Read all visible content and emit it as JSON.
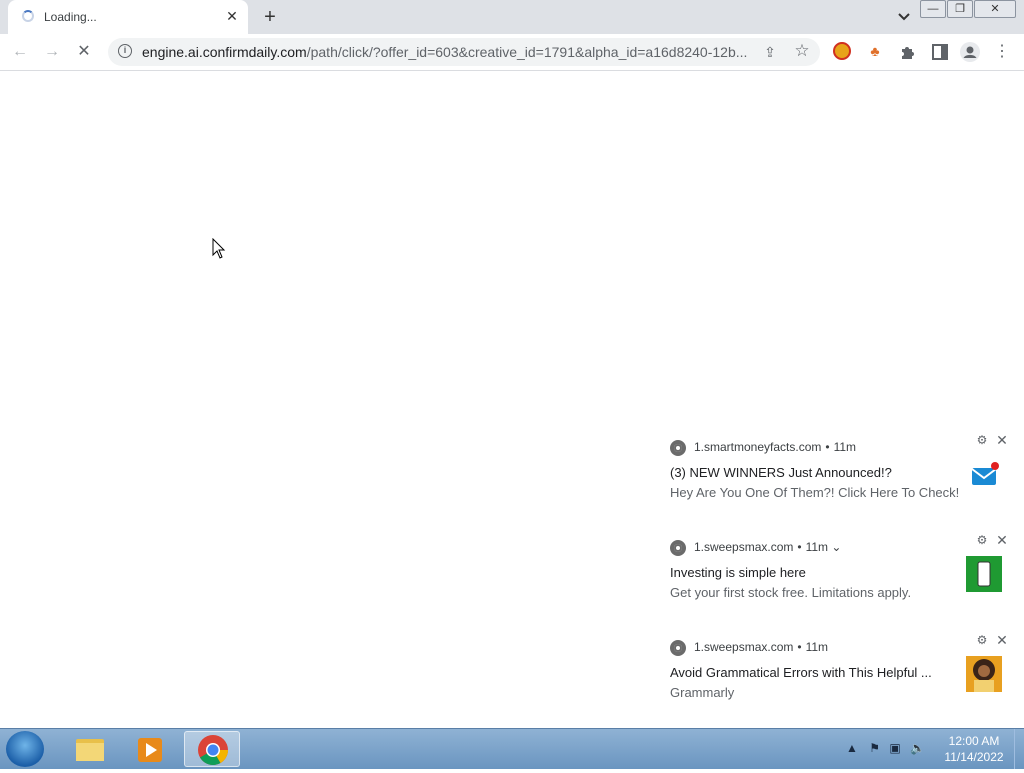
{
  "tab": {
    "title": "Loading...",
    "close": "✕",
    "new_tab": "+"
  },
  "window_controls": {
    "minimize": "—",
    "restore": "❐",
    "close": "✕"
  },
  "toolbar": {
    "back": "←",
    "forward": "→",
    "stop": "✕",
    "url_host": "engine.ai.confirmdaily.com",
    "url_rest": "/path/click/?offer_id=603&creative_id=1791&alpha_id=a16d8240-12b...",
    "menu": "⋮"
  },
  "notifications": [
    {
      "source": "1.smartmoneyfacts.com",
      "time": "11m",
      "title": "(3) NEW WINNERS Just Announced!?",
      "body": "Hey Are You One Of Them?! Click Here To Check!",
      "thumb_icon": "mail-icon"
    },
    {
      "source": "1.sweepsmax.com",
      "time": "11m",
      "expand": "⌄",
      "title": "Investing is simple here",
      "body": "Get your first stock free. Limitations apply.",
      "thumb_icon": "phone-icon"
    },
    {
      "source": "1.sweepsmax.com",
      "time": "11m",
      "title": "Avoid Grammatical Errors with This Helpful ...",
      "body": "Grammarly",
      "thumb_icon": "person-photo"
    }
  ],
  "taskbar": {
    "time": "12:00 AM",
    "date": "11/14/2022"
  },
  "colors": {
    "chrome_tab_bg": "#dee1e6",
    "taskbar": "#7aa3cb",
    "accent_blue": "#1a73e8"
  }
}
